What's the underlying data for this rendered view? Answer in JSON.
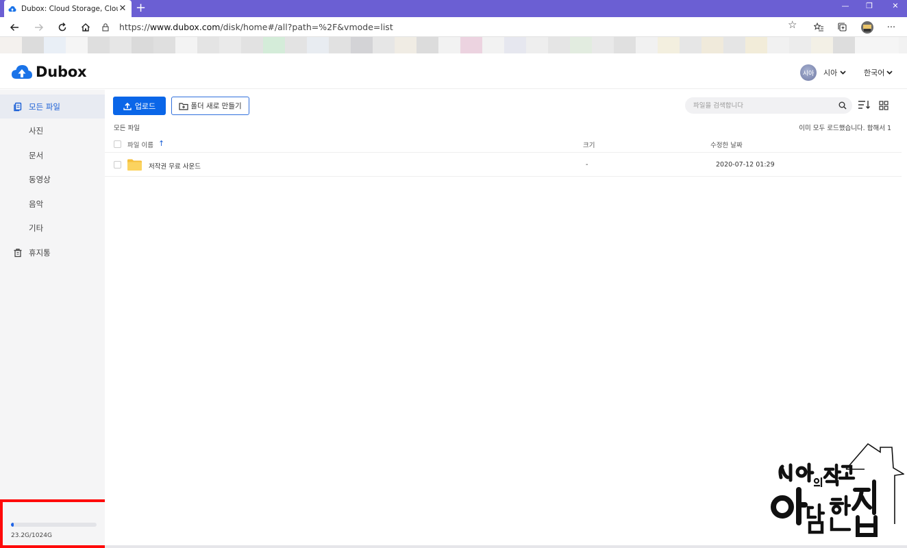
{
  "browser": {
    "tab_title": "Dubox: Cloud Storage, Cloud Ba",
    "tab_close": "✕",
    "new_tab": "+",
    "url_prefix": "https://",
    "url_domain": "www.dubox.com",
    "url_path": "/disk/home#/all?path=%2F&vmode=list",
    "window_buttons": [
      "—",
      "❐",
      "✕"
    ]
  },
  "app": {
    "logo_text": "Dubox",
    "user_name": "시아",
    "avatar_text": "시아",
    "language": "한국어"
  },
  "sidebar": {
    "items": [
      {
        "label": "모든 파일",
        "icon": "files-icon"
      },
      {
        "label": "사진"
      },
      {
        "label": "문서"
      },
      {
        "label": "동영상"
      },
      {
        "label": "음악"
      },
      {
        "label": "기타"
      },
      {
        "label": "휴지통",
        "icon": "trash-icon"
      }
    ],
    "storage": {
      "used_fraction": 0.0227,
      "label": "23.2G/1024G"
    }
  },
  "toolbar": {
    "upload_label": "업로드",
    "new_folder_label": "폴더 새로 만들기",
    "search_placeholder": "파일을 검색합니다"
  },
  "list": {
    "breadcrumb": "모든 파일",
    "loaded_status": "이미 모두 로드했습니다. 합해서 1",
    "headers": {
      "name": "파일 이름",
      "sort_arrow": "↑",
      "size": "크기",
      "modified": "수정한 날짜"
    },
    "rows": [
      {
        "name": "저작권 무료 사운드",
        "size": "-",
        "modified": "2020-07-12 01:29",
        "type": "folder"
      }
    ]
  },
  "watermark": {
    "text": "시아의 작고 아담한 집"
  },
  "colors": {
    "titlebar": "#6b5fd3",
    "primary": "#0a66e8",
    "highlight_box": "#ff0a0a",
    "folder": "#f7c948"
  }
}
